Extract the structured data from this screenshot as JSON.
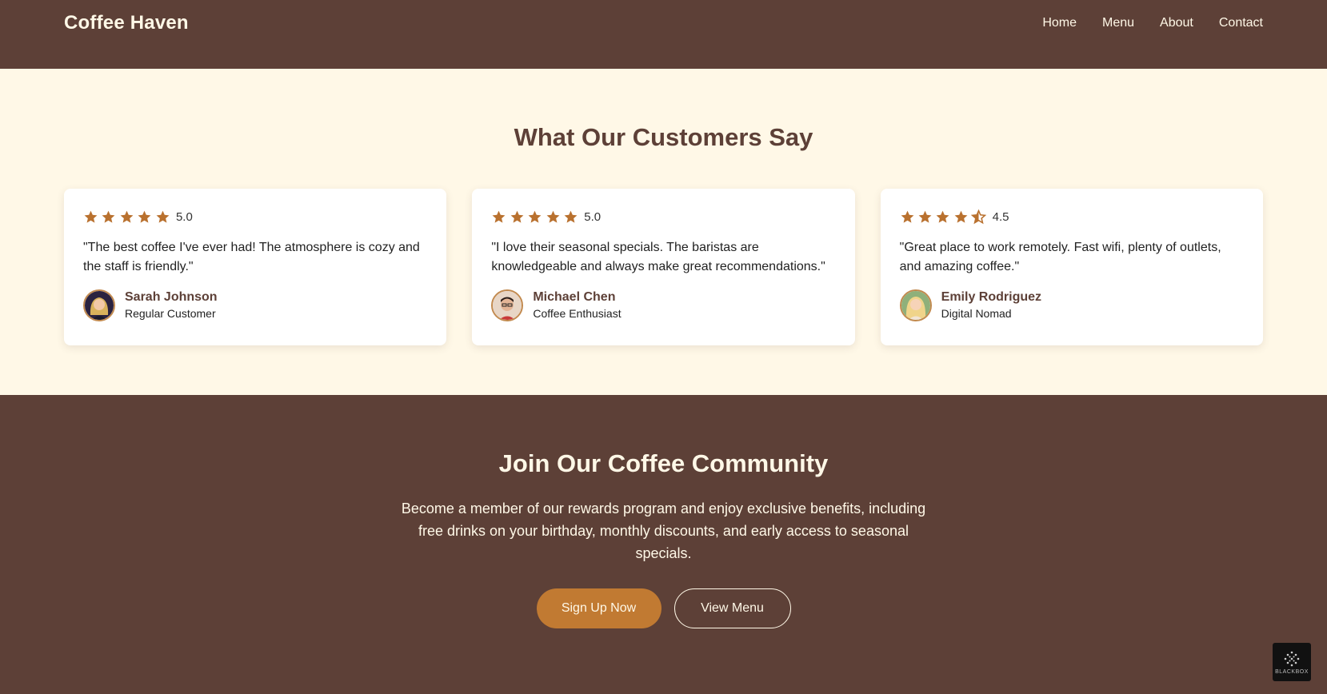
{
  "nav": {
    "brand": "Coffee Haven",
    "links": [
      "Home",
      "Menu",
      "About",
      "Contact"
    ]
  },
  "testimonials": {
    "title": "What Our Customers Say",
    "cards": [
      {
        "rating": 5.0,
        "rating_text": "5.0",
        "quote": "\"The best coffee I've ever had! The atmosphere is cozy and the staff is friendly.\"",
        "name": "Sarah Johnson",
        "role": "Regular Customer"
      },
      {
        "rating": 5.0,
        "rating_text": "5.0",
        "quote": "\"I love their seasonal specials. The baristas are knowledgeable and always make great recommendations.\"",
        "name": "Michael Chen",
        "role": "Coffee Enthusiast"
      },
      {
        "rating": 4.5,
        "rating_text": "4.5",
        "quote": "\"Great place to work remotely. Fast wifi, plenty of outlets, and amazing coffee.\"",
        "name": "Emily Rodriguez",
        "role": "Digital Nomad"
      }
    ]
  },
  "community": {
    "title": "Join Our Coffee Community",
    "text": "Become a member of our rewards program and enjoy exclusive benefits, including free drinks on your birthday, monthly discounts, and early access to seasonal specials.",
    "primary_button": "Sign Up Now",
    "secondary_button": "View Menu"
  },
  "badge": {
    "label": "BLACKBOX"
  },
  "colors": {
    "brown": "#5d4037",
    "cream": "#fff8e7",
    "accent": "#c17a32",
    "star": "#b9712f"
  }
}
